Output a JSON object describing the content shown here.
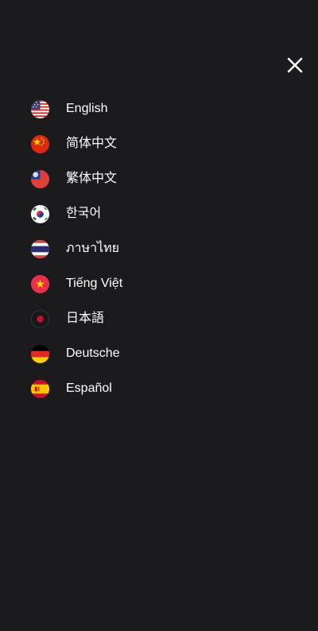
{
  "menu": {
    "close_icon": "close-icon",
    "languages": [
      {
        "label": "English",
        "flag": "us-flag-icon"
      },
      {
        "label": "简体中文",
        "flag": "china-flag-icon"
      },
      {
        "label": "繁体中文",
        "flag": "taiwan-flag-icon"
      },
      {
        "label": "한국어",
        "flag": "korea-flag-icon"
      },
      {
        "label": "ภาษาไทย",
        "flag": "thailand-flag-icon"
      },
      {
        "label": "Tiếng Việt",
        "flag": "vietnam-flag-icon"
      },
      {
        "label": "日本語",
        "flag": "japan-flag-icon"
      },
      {
        "label": "Deutsche",
        "flag": "germany-flag-icon"
      },
      {
        "label": "Español",
        "flag": "spain-flag-icon"
      }
    ]
  }
}
